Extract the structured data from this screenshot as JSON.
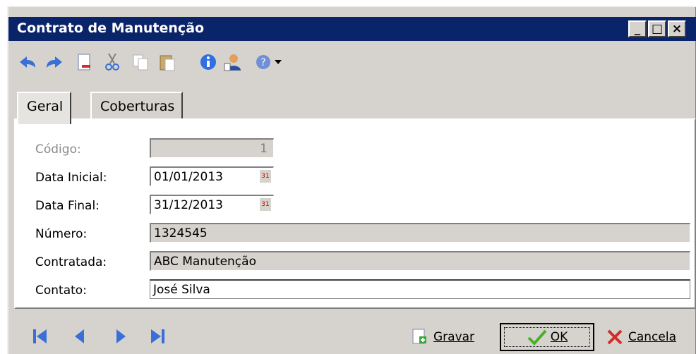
{
  "window": {
    "title": "Contrato de Manutenção",
    "buttons": {
      "minimize": "_",
      "maximize": "□",
      "close": "×"
    }
  },
  "toolbar": {
    "items": [
      "undo-icon",
      "redo-icon",
      "new-doc-icon",
      "cut-icon",
      "copy-icon",
      "paste-icon",
      "info-icon",
      "user-icon",
      "help-icon",
      "dropdown-icon"
    ]
  },
  "tabs": [
    {
      "label": "Geral",
      "active": true
    },
    {
      "label": "Coberturas",
      "active": false
    }
  ],
  "form": {
    "codigo": {
      "label": "Código:",
      "value": "1"
    },
    "data_inicial": {
      "label": "Data Inicial:",
      "value": "01/01/2013"
    },
    "data_final": {
      "label": "Data Final:",
      "value": "31/12/2013"
    },
    "numero": {
      "label": "Número:",
      "value": "1324545"
    },
    "contratada": {
      "label": "Contratada:",
      "value": "ABC Manutenção"
    },
    "contato": {
      "label": "Contato:",
      "value": "José Silva"
    }
  },
  "actions": {
    "gravar": "Gravar",
    "ok": "OK",
    "cancela": "Cancela"
  },
  "colors": {
    "titlebar": "#0a246a",
    "face": "#d6d3ce",
    "nav_blue": "#3a6fd8"
  }
}
